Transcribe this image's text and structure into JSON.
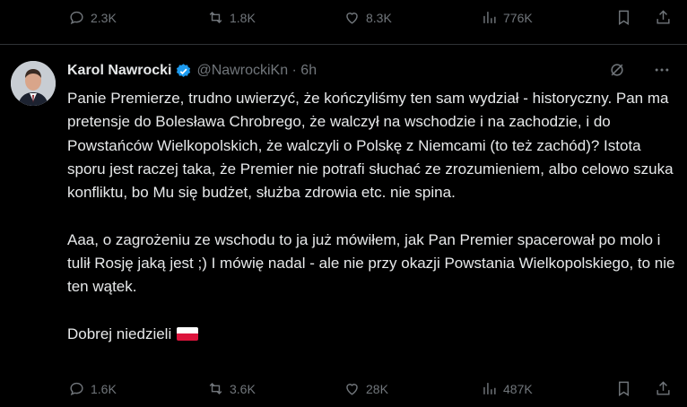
{
  "top_actions": {
    "replies": "2.3K",
    "reposts": "1.8K",
    "likes": "8.3K",
    "views": "776K"
  },
  "tweet": {
    "author_name": "Karol Nawrocki",
    "handle_time": "@NawrockiKn · 6h",
    "paragraph1": "Panie Premierze, trudno uwierzyć, że kończyliśmy ten sam wydział - historyczny. Pan ma pretensje do Bolesława Chrobrego, że walczył na wschodzie i na zachodzie, i do Powstańców Wielkopolskich, że walczyli o Polskę z Niemcami (to też zachód)? Istota sporu jest raczej taka, że Premier nie potrafi słuchać ze zrozumieniem, albo celowo szuka konfliktu, bo Mu się budżet, służba zdrowia etc. nie spina.",
    "paragraph2": "Aaa, o zagrożeniu ze wschodu to ja już mówiłem, jak Pan Premier spacerował po molo i tulił Rosję jaką jest ;) I mówię nadal - ale nie przy okazji Powstania Wielkopolskiego, to nie ten wątek.",
    "paragraph3": "Dobrej niedzieli",
    "flag_icon": "poland-flag-emoji"
  },
  "bottom_actions": {
    "replies": "1.6K",
    "reposts": "3.6K",
    "likes": "28K",
    "views": "487K"
  },
  "colors": {
    "background": "#000000",
    "text": "#e7e9ea",
    "muted": "#71767b",
    "verified": "#1d9bf0"
  }
}
